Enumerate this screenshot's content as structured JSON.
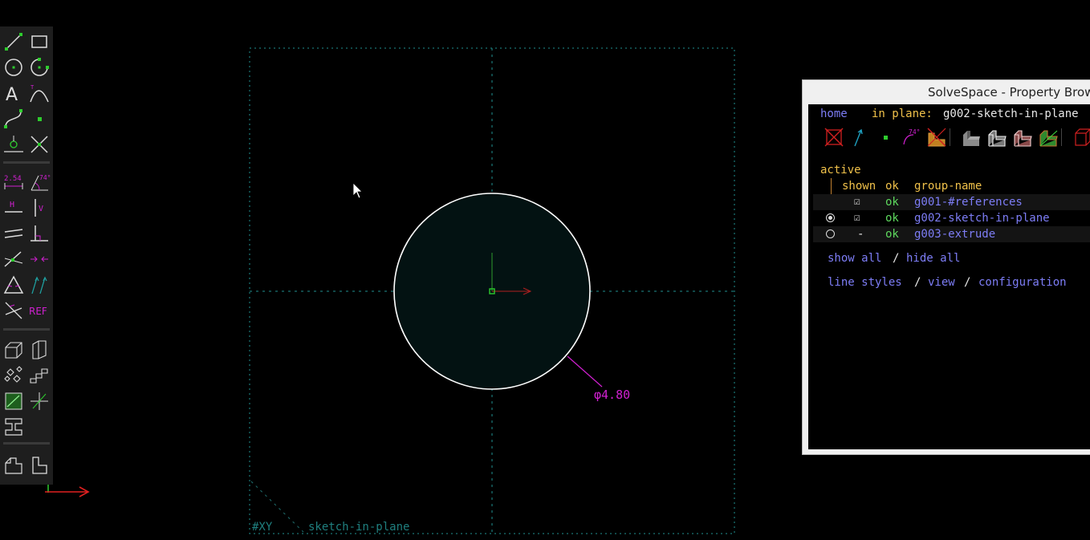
{
  "canvas": {
    "dimension_label": "φ4.80",
    "workplane_label": "#XY",
    "group_label": "sketch-in-plane"
  },
  "toolbar": {
    "tools": [
      {
        "name": "line-tool",
        "icon": "line-icon"
      },
      {
        "name": "rectangle-tool",
        "icon": "rectangle-icon"
      },
      {
        "name": "circle-tool",
        "icon": "circle-icon"
      },
      {
        "name": "arc-tool",
        "icon": "arc-icon"
      },
      {
        "name": "text-tool",
        "icon": "text-icon",
        "glyph": "A"
      },
      {
        "name": "tangent-arc-tool",
        "icon": "tangent-arc-icon"
      },
      {
        "name": "cubic-spline-tool",
        "icon": "spline-icon"
      },
      {
        "name": "point-tool",
        "icon": "point-icon"
      },
      {
        "name": "workplane-tool",
        "icon": "workplane-icon"
      },
      {
        "name": "split-curves-tool",
        "icon": "split-icon"
      },
      {
        "name": "distance-constraint",
        "icon": "distance-icon",
        "glyph": "2.54"
      },
      {
        "name": "angle-constraint",
        "icon": "angle-icon",
        "glyph": "74°"
      },
      {
        "name": "horizontal-constraint",
        "icon": "horizontal-icon",
        "glyph": "H"
      },
      {
        "name": "vertical-constraint",
        "icon": "vertical-icon",
        "glyph": "V"
      },
      {
        "name": "parallel-constraint",
        "icon": "parallel-icon"
      },
      {
        "name": "perpendicular-constraint",
        "icon": "perpendicular-icon"
      },
      {
        "name": "point-on-line-constraint",
        "icon": "point-on-line-icon"
      },
      {
        "name": "symmetric-constraint",
        "icon": "symmetric-icon"
      },
      {
        "name": "equal-constraint",
        "icon": "equal-icon"
      },
      {
        "name": "same-orientation-constraint",
        "icon": "orientation-icon"
      },
      {
        "name": "other-supplementary-constraint",
        "icon": "other-icon"
      },
      {
        "name": "reference-toggle",
        "icon": "ref-icon",
        "glyph": "REF"
      },
      {
        "name": "extrude-tool",
        "icon": "extrude-icon"
      },
      {
        "name": "lathe-tool",
        "icon": "lathe-icon"
      },
      {
        "name": "step-rotate-tool",
        "icon": "step-rotate-icon"
      },
      {
        "name": "step-translate-tool",
        "icon": "step-translate-icon"
      },
      {
        "name": "sketch-in-workplane-tool",
        "icon": "sketch-workplane-icon"
      },
      {
        "name": "sketch-3d-tool",
        "icon": "sketch-3d-icon"
      },
      {
        "name": "assemble-tool",
        "icon": "assemble-icon"
      },
      {
        "name": "in-workplane-tool",
        "icon": "in-workplane-icon"
      },
      {
        "name": "nearest-ortho-tool",
        "icon": "ortho-icon"
      }
    ]
  },
  "property_browser": {
    "window_title": "SolveSpace - Property Browser",
    "home_link": "home",
    "in_plane_label": "in plane:",
    "in_plane_value": "g002-sketch-in-plane",
    "active_label": "active",
    "header": {
      "shown": "shown",
      "ok": "ok",
      "group_name": "group-name"
    },
    "groups": [
      {
        "active": "",
        "shown": "☑",
        "ok": "ok",
        "name": "g001-#references"
      },
      {
        "active": "radio-on",
        "shown": "☑",
        "ok": "ok",
        "name": "g002-sketch-in-plane"
      },
      {
        "active": "radio-off",
        "shown": "-",
        "ok": "ok",
        "name": "g003-extrude"
      }
    ],
    "show_all": "show all",
    "slash1": "/",
    "hide_all": "hide all",
    "line_styles": "line styles",
    "slash2": "/",
    "view": "view",
    "slash3": "/",
    "configuration": "configuration",
    "filter_icons": [
      "workplanes-filter-icon",
      "normals-filter-icon",
      "points-filter-icon",
      "constraints-filter-icon",
      "faces-filter-icon",
      "shaded-filter-icon",
      "edges-filter-icon",
      "mesh-filter-icon",
      "outline-filter-icon",
      "hidden-lines-filter-icon",
      "construction-filter-icon"
    ]
  }
}
